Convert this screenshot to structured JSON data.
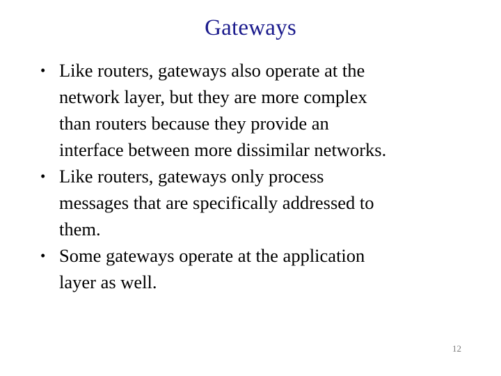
{
  "slide": {
    "title": "Gateways",
    "title_color": "#1a1a8c",
    "background_color": "#ffffff",
    "text_color": "#000000",
    "bullet_glyph": "•",
    "bullets": [
      {
        "marker": "•",
        "text": "Like routers, gateways also operate at the\nnetwork layer, but they are more complex\nthan routers because they provide an\ninterface between more dissimilar networks."
      },
      {
        "marker": "•",
        "text": "Like routers, gateways only process\nmessages that are specifically addressed to\nthem."
      },
      {
        "marker": "•",
        "text": "Some gateways operate at the application\nlayer as well."
      }
    ],
    "page_number": "12",
    "page_number_color": "#7a7a7a"
  }
}
